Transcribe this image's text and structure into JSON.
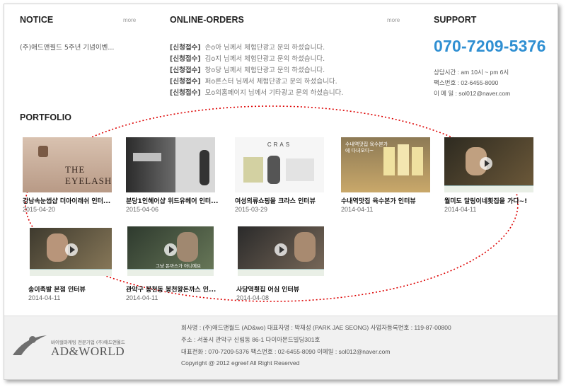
{
  "notice": {
    "title": "NOTICE",
    "more": "more",
    "item": "(주)애드앤월드 5주년 기념이벤..."
  },
  "orders": {
    "title": "ONLINE-ORDERS",
    "more": "more",
    "rows": [
      {
        "tag": "[신청접수]",
        "text": "손o아 님께서 체험단광고 문의 하셨습니다."
      },
      {
        "tag": "[신청접수]",
        "text": "김o지 님께서 체험단광고 문의 하셨습니다."
      },
      {
        "tag": "[신청접수]",
        "text": "창o당 님께서 체험단광고 문의 하셨습니다."
      },
      {
        "tag": "[신청접수]",
        "text": "퍼o른스터 님께서 체험단광고 문의 하셨습니다."
      },
      {
        "tag": "[신청접수]",
        "text": "모o의홈페이지 님께서 기타광고 문의 하셨습니다."
      }
    ]
  },
  "support": {
    "title": "SUPPORT",
    "phone": "070-7209-5376",
    "hours": "상담시간 : am 10시 ~ pm 6시",
    "fax": "팩스번호 : 02-6455-8090",
    "email": "이 메 일 : sol012@naver.com"
  },
  "portfolio": {
    "title": "PORTFOLIO",
    "items": [
      {
        "title": "강남속눈썹샵 더아이래쉬 인터...",
        "date": "2015-04-20",
        "thumb_text": "THE EYELASH"
      },
      {
        "title": "분당1인헤어샵 위드유헤어 인터...",
        "date": "2015-04-06",
        "thumb_text": ""
      },
      {
        "title": "여성의류쇼핑몰 크라스 인터뷰",
        "date": "2015-03-29",
        "thumb_text": "CRAS"
      },
      {
        "title": "수내역맛집 육수본가 인터뷰",
        "date": "2014-04-11",
        "thumb_text": "수내역맛집 육수본가에 다녀오다~"
      },
      {
        "title": "월미도 달링이네횟집을 가다~!",
        "date": "2014-04-11",
        "thumb_text": ""
      },
      {
        "title": "송이족발 본점 인터뷰",
        "date": "2014-04-11",
        "thumb_text": ""
      },
      {
        "title": "관악구 봉천동 봉천왕돈까스 인...",
        "date": "2014-04-11",
        "thumb_text": "그냥 돈까스가 아니에요"
      },
      {
        "title": "사당역횟집 어심 인터뷰",
        "date": "2014-04-08",
        "thumb_text": ""
      }
    ]
  },
  "footer": {
    "line1": "회사명 : (주)애드앤월드 (AD&wo) 대표자명 : 박재성 (PARK JAE SEONG)   사업자등록번호 : 119-87-00800",
    "line2": "주소 : 서울시 관악구 신림동 86-1 다이아몬드빌딩301호",
    "line3": "대표전화 : 070-7209-5376 팩스번호 : 02-6455-8090 이메일 : sol012@naver.com",
    "copyright": "Copyright @ 2012 egreef All Right Reserved",
    "logo_small": "바이럴마케팅 전문기업 (주)애드앤월드",
    "logo_main": "AD&WORLD"
  }
}
